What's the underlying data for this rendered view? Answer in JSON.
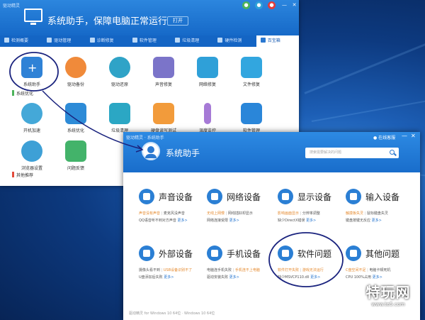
{
  "window1": {
    "brand": "驱动精灵",
    "title": "系统助手，保障电脑正常运行",
    "open_button": "打开",
    "controls": [
      "●",
      "●",
      "●",
      "—",
      "✕"
    ],
    "tabs": [
      {
        "label": "检测概要",
        "icon": "home-icon"
      },
      {
        "label": "驱动管理",
        "icon": "driver-icon"
      },
      {
        "label": "诊断修复",
        "icon": "wrench-icon"
      },
      {
        "label": "软件管理",
        "icon": "software-icon"
      },
      {
        "label": "垃圾清理",
        "icon": "trash-icon"
      },
      {
        "label": "硬件检测",
        "icon": "hardware-icon"
      },
      {
        "label": "百宝箱",
        "icon": "toolbox-icon"
      }
    ],
    "row1": [
      {
        "label": "系统助手",
        "color": "#2f82d6"
      },
      {
        "label": "驱动备份",
        "color": "#f08a3a"
      },
      {
        "label": "驱动还原",
        "color": "#2fa3c7"
      },
      {
        "label": "声音修复",
        "color": "#7b74c9"
      },
      {
        "label": "网络修复",
        "color": "#2fa0d8"
      },
      {
        "label": "文件修复",
        "color": "#32a6df"
      }
    ],
    "section1": "系统优化",
    "row2": [
      {
        "label": "开机加速",
        "color": "#44a8d8"
      },
      {
        "label": "系统优化",
        "color": "#2d8bd7"
      },
      {
        "label": "垃圾清理",
        "color": "#2ba7c4"
      },
      {
        "label": "硬盘读写测试",
        "color": "#f29b3b"
      },
      {
        "label": "温度监控",
        "color": "#a67ad6"
      },
      {
        "label": "软件管理",
        "color": "#2a86d9"
      }
    ],
    "row3": [
      {
        "label": "浏览器设置",
        "color": "#3ea0d6"
      },
      {
        "label": "问题反馈",
        "color": "#43b36a"
      }
    ],
    "section2": "其他推荐"
  },
  "window2": {
    "brand": "驱动精灵 · 系统助手",
    "title": "系统助手",
    "online": "在线客服",
    "search_placeholder": "搜索需要解决的问题",
    "cards": [
      {
        "title": "声音设备",
        "line1": [
          "声音没有声音",
          "麦克风没声音"
        ],
        "line2": [
          "QQ语音听不到对方声音"
        ],
        "more": "更多>"
      },
      {
        "title": "网络设备",
        "line1": [
          "无线上网慢",
          "网线插好却显示"
        ],
        "line2": [
          "网络连接受限"
        ],
        "more": "更多>"
      },
      {
        "title": "显示设备",
        "line1": [
          "影响画面显示",
          "分辨率调整"
        ],
        "line2": [
          "缺少DirectX错误"
        ],
        "more": "更多>"
      },
      {
        "title": "输入设备",
        "line1": [
          "触摸板失灵",
          "鼠标键盘失灵"
        ],
        "line2": [
          "键盘按键无反应"
        ],
        "more": "更多>"
      },
      {
        "title": "外部设备",
        "line1": [
          "摄像头看不到",
          "USB设备识别不了"
        ],
        "line2": [
          "U盘添加后失败"
        ],
        "more": "更多>"
      },
      {
        "title": "手机设备",
        "line1": [
          "电脑连手机失败",
          "手机连不上电脑"
        ],
        "line2": [
          "驱动安装失败"
        ],
        "more": "更多>"
      },
      {
        "title": "软件问题",
        "line1": [
          "软件打开失败",
          "游戏无法运行"
        ],
        "line2": [
          "缺少MSVCP110.dll"
        ],
        "more": "更多>"
      },
      {
        "title": "其他问题",
        "line1": [
          "C盘空间不足",
          "电脑卡顿死机"
        ],
        "line2": [
          "CPU 100%占用"
        ],
        "more": "更多>"
      }
    ],
    "footer": "驱动精灵 for Windows 10 64位 · Windows 10 64位"
  },
  "watermark": {
    "logo": "特玩网",
    "url": "www.te5.com"
  },
  "colors": {
    "accent": "#1e6fcc",
    "orange": "#e58a2f",
    "annotation": "#1a237e"
  }
}
